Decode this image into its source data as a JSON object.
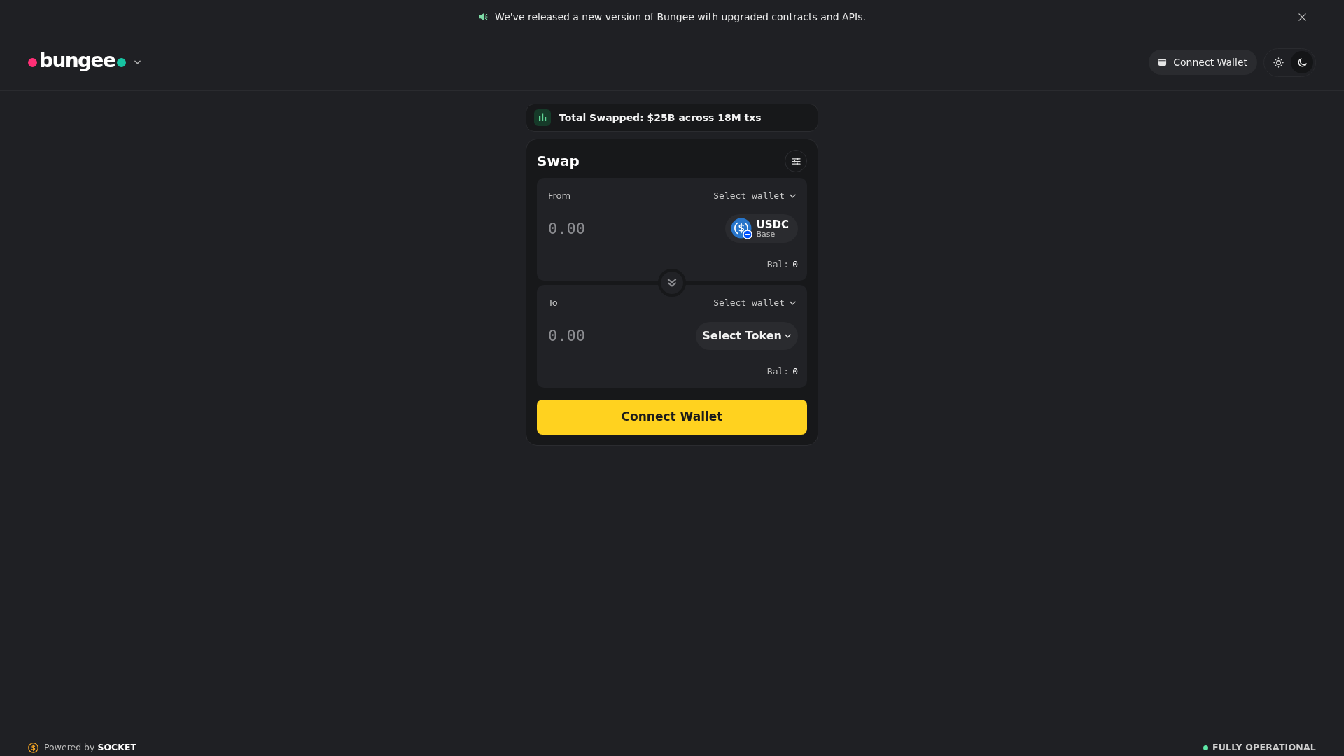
{
  "announcement": {
    "text": "We've released a new version of Bungee with upgraded contracts and APIs."
  },
  "header": {
    "logo": "bungee",
    "wallet_button": "Connect Wallet",
    "theme_options": [
      {
        "kind": "light",
        "selected": false
      },
      {
        "kind": "dark",
        "selected": true
      }
    ]
  },
  "stats": {
    "text": "Total Swapped: $25B across 18M txs"
  },
  "swap": {
    "title": "Swap",
    "panels": [
      {
        "label": "From",
        "wallet_select": "Select wallet",
        "amount": {
          "placeholder": "0.00"
        },
        "token": {
          "kind": "chosen",
          "symbol": "USDC",
          "network": "Base"
        },
        "balance_label": "Bal:",
        "balance": "0"
      },
      {
        "label": "To",
        "wallet_select": "Select wallet",
        "amount": {
          "placeholder": "0.00"
        },
        "token": {
          "kind": "picker",
          "label": "Select Token"
        },
        "balance_label": "Bal:",
        "balance": "0"
      }
    ],
    "action_button": "Connect Wallet"
  },
  "footer": {
    "powered_by": "Powered by **SOCKET**",
    "status": "FULLY OPERATIONAL"
  }
}
